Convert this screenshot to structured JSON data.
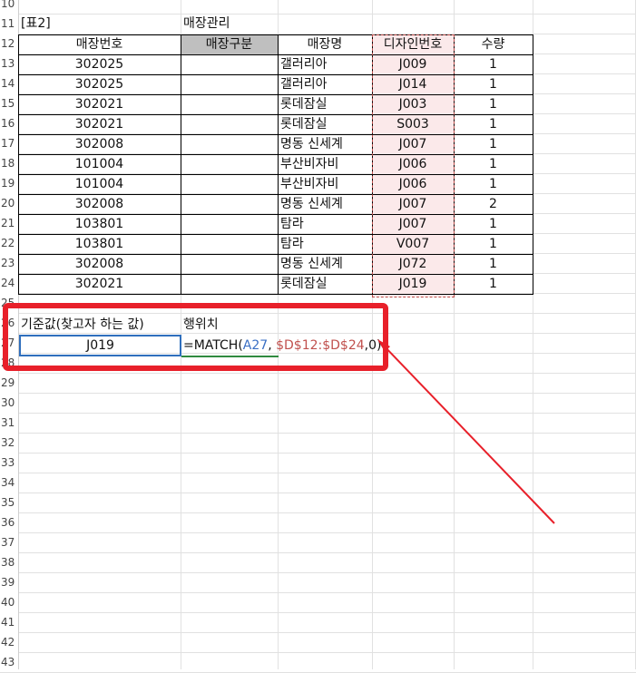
{
  "rows": {
    "numbers": [
      "10",
      "11",
      "12",
      "13",
      "14",
      "15",
      "16",
      "17",
      "18",
      "19",
      "20",
      "21",
      "22",
      "23",
      "24",
      "25",
      "26",
      "27",
      "28",
      "29",
      "30",
      "31",
      "32",
      "33",
      "34",
      "35",
      "36",
      "37",
      "38",
      "39",
      "40",
      "41",
      "42",
      "43"
    ]
  },
  "header_labels": {
    "table_label": "[표2]",
    "title": "매장관리"
  },
  "table": {
    "columns": [
      "매장번호",
      "매장구분",
      "매장명",
      "디자인번호",
      "수량"
    ],
    "rows": [
      [
        "302025",
        "",
        "갤러리아",
        "J009",
        "1"
      ],
      [
        "302025",
        "",
        "갤러리아",
        "J014",
        "1"
      ],
      [
        "302021",
        "",
        "롯데잠실",
        "J003",
        "1"
      ],
      [
        "302021",
        "",
        "롯데잠실",
        "S003",
        "1"
      ],
      [
        "302008",
        "",
        "명동 신세계",
        "J007",
        "1"
      ],
      [
        "101004",
        "",
        "부산비자비",
        "J006",
        "1"
      ],
      [
        "101004",
        "",
        "부산비자비",
        "J006",
        "1"
      ],
      [
        "302008",
        "",
        "명동 신세계",
        "J007",
        "2"
      ],
      [
        "103801",
        "",
        "탐라",
        "J007",
        "1"
      ],
      [
        "103801",
        "",
        "탐라",
        "V007",
        "1"
      ],
      [
        "302008",
        "",
        "명동 신세계",
        "J072",
        "1"
      ],
      [
        "302021",
        "",
        "롯데잠실",
        "J019",
        "1"
      ]
    ]
  },
  "lookup": {
    "criteria_label": "기준값(찾고자 하는 값)",
    "result_label": "행위치",
    "criteria_value": "J019",
    "formula_parts": {
      "prefix": "=MATCH(",
      "arg1": "A27",
      "sep": ", ",
      "arg2": "$D$12:$D$24",
      "suffix": ",0)"
    }
  },
  "colors": {
    "callout": "#e8202a",
    "range_highlight": "#fbe9ea",
    "header_gray": "#bfbfbf",
    "ref_blue": "#3a6fc4",
    "ref_red": "#c0504d"
  }
}
